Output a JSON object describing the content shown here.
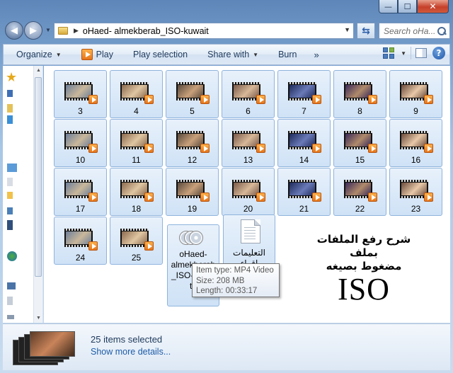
{
  "window": {
    "caption": {
      "minimize": "—",
      "maximize": "☐",
      "close": "✕"
    }
  },
  "address": {
    "path": "oHaed- almekberab_ISO-kuwait",
    "search_placeholder": "Search oHa..."
  },
  "toolbar": {
    "organize": "Organize",
    "play": "Play",
    "play_selection": "Play selection",
    "share_with": "Share with",
    "burn": "Burn",
    "more": "»"
  },
  "items": [
    {
      "label": "3"
    },
    {
      "label": "4"
    },
    {
      "label": "5"
    },
    {
      "label": "6"
    },
    {
      "label": "7"
    },
    {
      "label": "8"
    },
    {
      "label": "9"
    },
    {
      "label": "10"
    },
    {
      "label": "11"
    },
    {
      "label": "12"
    },
    {
      "label": "13"
    },
    {
      "label": "14"
    },
    {
      "label": "15"
    },
    {
      "label": "16"
    },
    {
      "label": "17"
    },
    {
      "label": "18"
    },
    {
      "label": "19"
    },
    {
      "label": "20"
    },
    {
      "label": "21"
    },
    {
      "label": "22"
    },
    {
      "label": "23"
    },
    {
      "label": "24"
    },
    {
      "label": "25"
    }
  ],
  "iso_file": {
    "lines": [
      "oHaed-",
      "almekberab",
      "_ISO-kuwai",
      "t3"
    ]
  },
  "text_file": {
    "lines": [
      "التعليمات",
      "إقراء"
    ]
  },
  "overlay": {
    "line1": "شرح رفع الملفات بملف",
    "line2": "مضغوط بصيغه",
    "big": "ISO"
  },
  "tooltip": {
    "type": "Item type: MP4 Video",
    "size": "Size: 208 MB",
    "length": "Length: 00:33:17"
  },
  "details": {
    "count": "25 items selected",
    "link": "Show more details..."
  },
  "colors": {
    "selection": "#cfe2f6",
    "selection_border": "#8fb3dd",
    "link": "#1d5ca8",
    "play_badge": "#e6751a"
  }
}
